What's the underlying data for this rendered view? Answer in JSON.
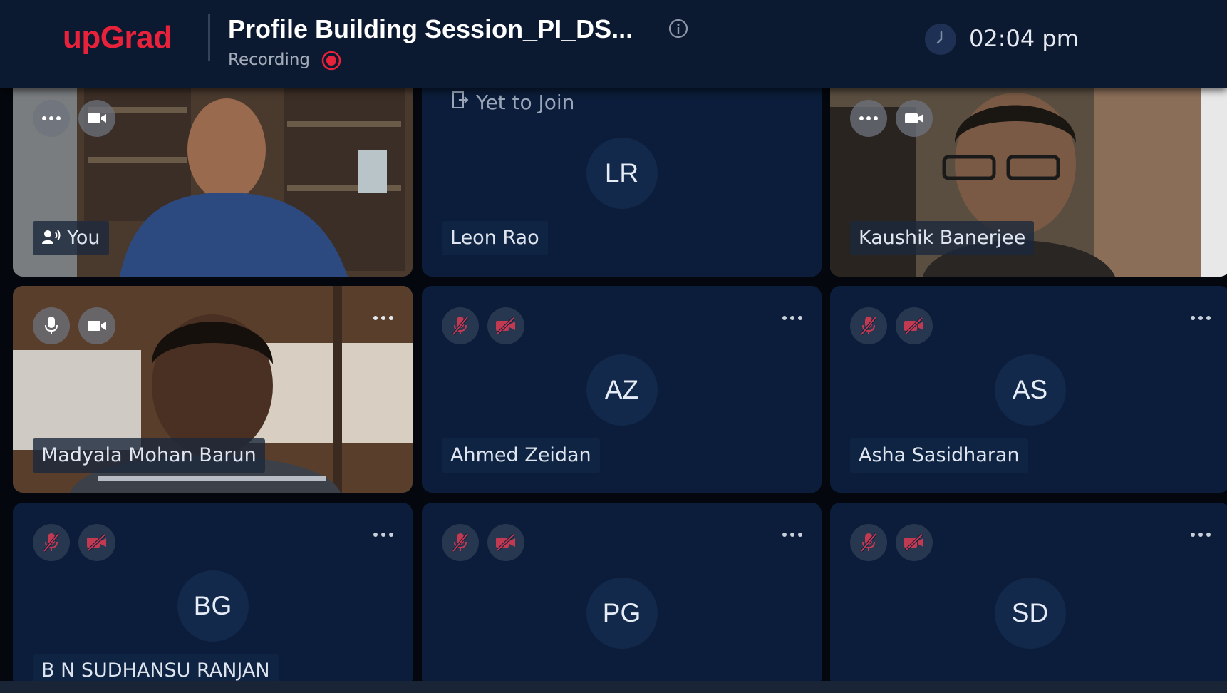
{
  "header": {
    "logo": "upGrad",
    "session_title": "Profile Building Session_PI_DS...",
    "recording_label": "Recording",
    "time": "02:04 pm"
  },
  "colors": {
    "brand": "#e8223a",
    "header_bg": "#0c1a31",
    "tile_bg": "#0b1d3a",
    "muted_icon": "#c23a52"
  },
  "participants": [
    {
      "name": "You",
      "video": true,
      "speaking": true
    },
    {
      "name": "Leon Rao",
      "initials": "LR",
      "status": "Yet to Join"
    },
    {
      "name": "Kaushik Banerjee",
      "video": true
    },
    {
      "name": "Madyala Mohan Barun",
      "video": true
    },
    {
      "name": "Ahmed Zeidan",
      "initials": "AZ",
      "mic": "off",
      "camera": "off"
    },
    {
      "name": "Asha Sasidharan",
      "initials": "AS",
      "mic": "off",
      "camera": "off"
    },
    {
      "name": "B N SUDHANSU RANJAN",
      "initials": "BG",
      "mic": "off",
      "camera": "off"
    },
    {
      "initials": "PG",
      "mic": "off",
      "camera": "off"
    },
    {
      "initials": "SD",
      "mic": "off",
      "camera": "off"
    }
  ]
}
